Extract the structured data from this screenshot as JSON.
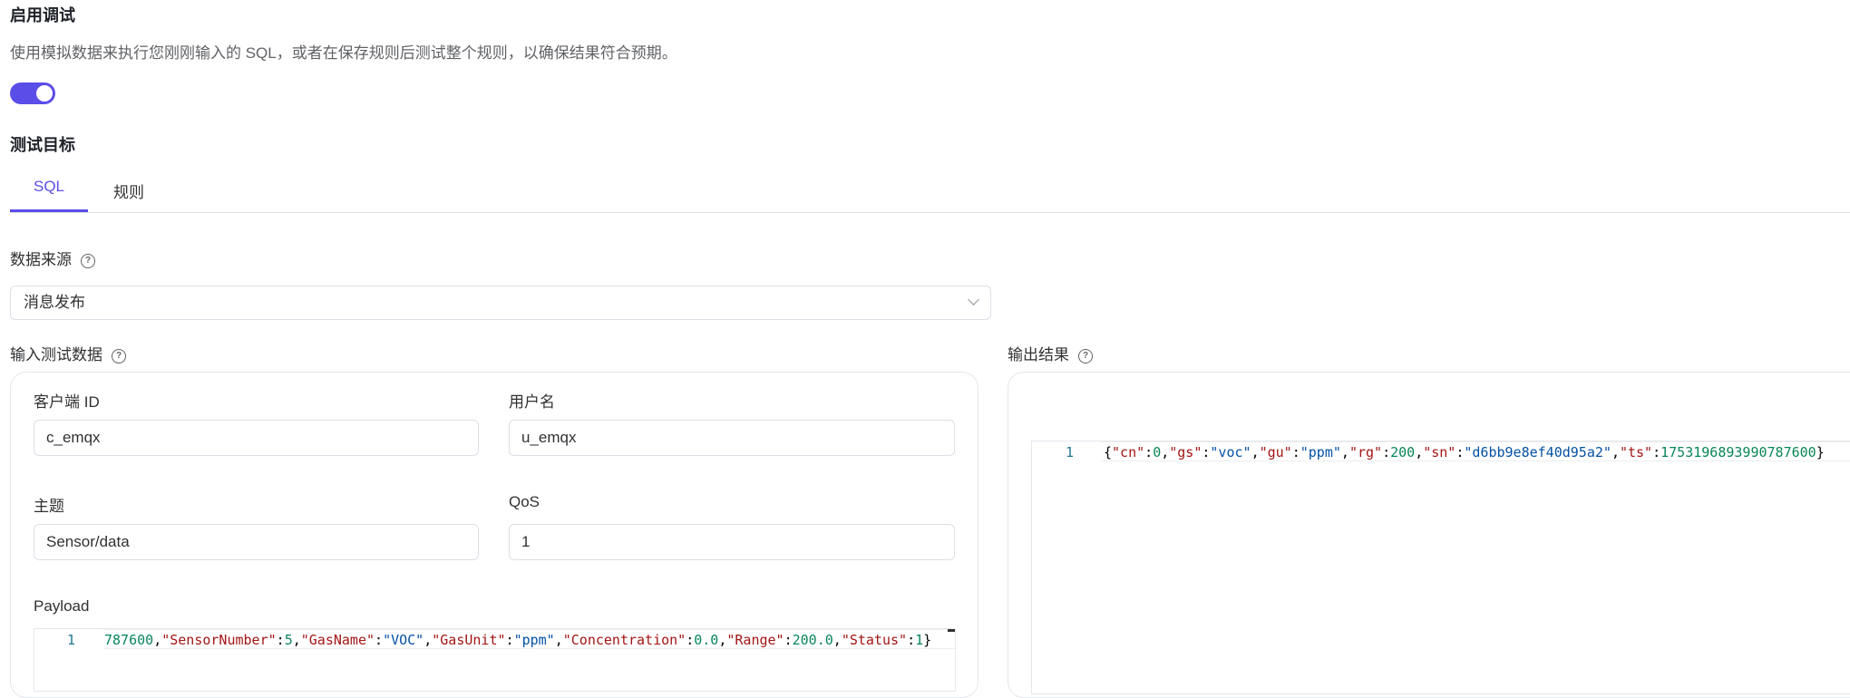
{
  "debug": {
    "title": "启用调试",
    "description": "使用模拟数据来执行您刚刚输入的 SQL，或者在保存规则后测试整个规则，以确保结果符合预期。",
    "enabled": true
  },
  "test_target": {
    "title": "测试目标",
    "tabs": [
      {
        "label": "SQL",
        "active": true
      },
      {
        "label": "规则",
        "active": false
      }
    ]
  },
  "data_source": {
    "label": "数据来源",
    "value": "消息发布"
  },
  "input": {
    "label": "输入测试数据",
    "client_id_label": "客户端 ID",
    "client_id_value": "c_emqx",
    "username_label": "用户名",
    "username_value": "u_emqx",
    "topic_label": "主题",
    "topic_value": "Sensor/data",
    "qos_label": "QoS",
    "qos_value": "1",
    "payload_label": "Payload",
    "payload_line_number": "1",
    "payload_tokens": [
      {
        "t": "787600",
        "c": "n"
      },
      {
        "t": ",",
        "c": "p"
      },
      {
        "t": "\"SensorNumber\"",
        "c": "k"
      },
      {
        "t": ":",
        "c": "p"
      },
      {
        "t": "5",
        "c": "n"
      },
      {
        "t": ",",
        "c": "p"
      },
      {
        "t": "\"GasName\"",
        "c": "k"
      },
      {
        "t": ":",
        "c": "p"
      },
      {
        "t": "\"VOC\"",
        "c": "s"
      },
      {
        "t": ",",
        "c": "p"
      },
      {
        "t": "\"GasUnit\"",
        "c": "k"
      },
      {
        "t": ":",
        "c": "p"
      },
      {
        "t": "\"ppm\"",
        "c": "s"
      },
      {
        "t": ",",
        "c": "p"
      },
      {
        "t": "\"Concentration\"",
        "c": "k"
      },
      {
        "t": ":",
        "c": "p"
      },
      {
        "t": "0.0",
        "c": "n"
      },
      {
        "t": ",",
        "c": "p"
      },
      {
        "t": "\"Range\"",
        "c": "k"
      },
      {
        "t": ":",
        "c": "p"
      },
      {
        "t": "200.0",
        "c": "n"
      },
      {
        "t": ",",
        "c": "p"
      },
      {
        "t": "\"Status\"",
        "c": "k"
      },
      {
        "t": ":",
        "c": "p"
      },
      {
        "t": "1",
        "c": "n"
      },
      {
        "t": "}",
        "c": "p"
      }
    ]
  },
  "output": {
    "label": "输出结果",
    "line_number": "1",
    "tokens": [
      {
        "t": "{",
        "c": "p"
      },
      {
        "t": "\"cn\"",
        "c": "k"
      },
      {
        "t": ":",
        "c": "p"
      },
      {
        "t": "0",
        "c": "n"
      },
      {
        "t": ",",
        "c": "p"
      },
      {
        "t": "\"gs\"",
        "c": "k"
      },
      {
        "t": ":",
        "c": "p"
      },
      {
        "t": "\"voc\"",
        "c": "s"
      },
      {
        "t": ",",
        "c": "p"
      },
      {
        "t": "\"gu\"",
        "c": "k"
      },
      {
        "t": ":",
        "c": "p"
      },
      {
        "t": "\"ppm\"",
        "c": "s"
      },
      {
        "t": ",",
        "c": "p"
      },
      {
        "t": "\"rg\"",
        "c": "k"
      },
      {
        "t": ":",
        "c": "p"
      },
      {
        "t": "200",
        "c": "n"
      },
      {
        "t": ",",
        "c": "p"
      },
      {
        "t": "\"sn\"",
        "c": "k"
      },
      {
        "t": ":",
        "c": "p"
      },
      {
        "t": "\"d6bb9e8ef40d95a2\"",
        "c": "s"
      },
      {
        "t": ",",
        "c": "p"
      },
      {
        "t": "\"ts\"",
        "c": "k"
      },
      {
        "t": ":",
        "c": "p"
      },
      {
        "t": "1753196893990787600",
        "c": "n"
      },
      {
        "t": "}",
        "c": "p"
      }
    ]
  },
  "colors": {
    "accent": "#5b4de8",
    "json_key": "#a31515",
    "json_string": "#0451a5",
    "json_number": "#098658",
    "line_number": "#237893"
  },
  "icons": {
    "help": "question-circle-icon",
    "select": "chevron-down-icon"
  }
}
